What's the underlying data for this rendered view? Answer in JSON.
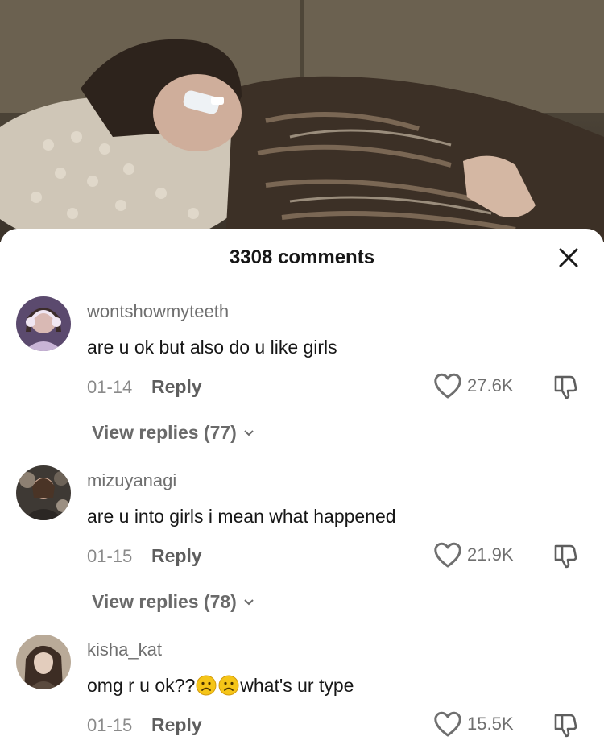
{
  "panel": {
    "title": "3308 comments",
    "close_icon": "close-icon"
  },
  "comments": [
    {
      "username": "wontshowmyteeth",
      "text": "are u ok but also do u like girls",
      "date": "01-14",
      "reply_label": "Reply",
      "likes": "27.6K",
      "view_replies": "View replies (77)"
    },
    {
      "username": "mizuyanagi",
      "text": "are u into girls i mean what happened",
      "date": "01-15",
      "reply_label": "Reply",
      "likes": "21.9K",
      "view_replies": "View replies (78)"
    },
    {
      "username": "kisha_kat",
      "text_before": "omg r u ok??",
      "text_after": "what's ur type",
      "emoji": "frowning-face-emoji",
      "date": "01-15",
      "reply_label": "Reply",
      "likes": "15.5K"
    }
  ],
  "colors": {
    "text": "#161616",
    "muted": "#6f6f6f",
    "emoji": "#f5c518"
  }
}
